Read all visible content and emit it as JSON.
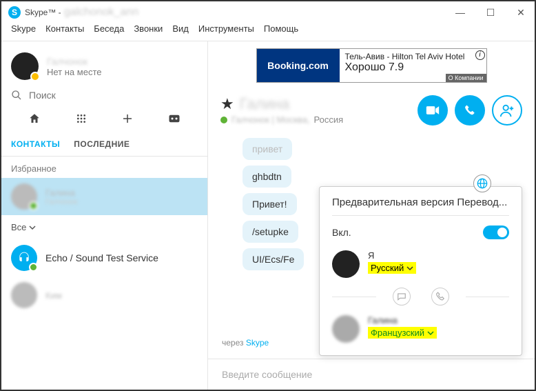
{
  "titlebar": {
    "app": "Skype™ -",
    "user": "galchonok_ann"
  },
  "menu": [
    "Skype",
    "Контакты",
    "Беседа",
    "Звонки",
    "Вид",
    "Инструменты",
    "Помощь"
  ],
  "profile": {
    "name": "Галчонок",
    "status": "Нет на месте"
  },
  "search": {
    "placeholder": "Поиск"
  },
  "tabs": {
    "contacts": "КОНТАКТЫ",
    "recent": "ПОСЛЕДНИЕ"
  },
  "sections": {
    "fav": "Избранное",
    "all": "Все"
  },
  "contacts": {
    "selected": {
      "name": "Галина",
      "sub": "Галчонок"
    },
    "echo": "Echo / Sound Test Service",
    "other": "Ким"
  },
  "ad": {
    "brand": "Booking.com",
    "line1": "Тель-Авив - Hilton Tel Aviv Hotel",
    "line2": "Хорошо 7.9",
    "comp": "О Компании"
  },
  "chat": {
    "name": "Галина",
    "loc_blurred": "Галчонок | Москва,",
    "loc_visible": "Россия",
    "messages": [
      "привет",
      "ghbdtn",
      "Привет!",
      "/setupke",
      "UI/Ecs/Fe"
    ],
    "via_pre": "через ",
    "via_link": "Skype",
    "input_placeholder": "Введите сообщение"
  },
  "popup": {
    "title": "Предварительная версия Перевод...",
    "toggle_label": "Вкл.",
    "me": {
      "label": "Я",
      "lang": "Русский"
    },
    "them": {
      "name": "Галина",
      "lang": "Французский"
    }
  }
}
